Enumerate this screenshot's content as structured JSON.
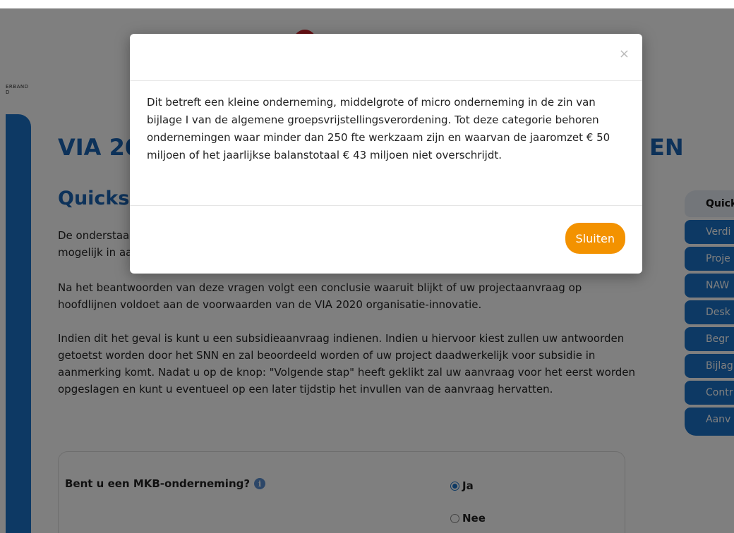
{
  "header": {
    "logo_text_line1": "ERBAND",
    "logo_text_line2": "D"
  },
  "main": {
    "title_left": "VIA 20",
    "title_right": "EN",
    "subtitle": "Quicks",
    "intro_line1": "De onderstaa",
    "intro_line2": "mogelijk in aa",
    "paragraph2": "Na het beantwoorden van deze vragen volgt een conclusie waaruit blijkt of uw projectaanvraag op hoofdlijnen voldoet aan de voorwaarden van de VIA 2020 organisatie-innovatie.",
    "paragraph3": "Indien dit het geval is kunt u een subsidieaanvraag indienen. Indien u hiervoor kiest zullen uw antwoorden getoetst worden door het SNN en zal beoordeeld worden of uw project daadwerkelijk voor subsidie in aanmerking komt. Nadat u op de knop: \"Volgende stap\" heeft geklikt zal uw aanvraag voor het eerst worden opgeslagen en kunt u eventueel op een later tijdstip het invullen van de aanvraag hervatten."
  },
  "form": {
    "question": "Bent u een MKB-onderneming?",
    "info_icon": "i",
    "options": [
      "Ja",
      "Nee"
    ],
    "selected": "Ja"
  },
  "side_nav": {
    "items": [
      "Quick",
      "Verdi",
      "Proje",
      "NAW",
      "Desk",
      "Begr",
      "Bijlag",
      "Contr",
      "Aanv"
    ]
  },
  "modal": {
    "close_symbol": "×",
    "body": "Dit betreft een kleine onderneming, middelgrote of micro onderneming in de zin van bijlage I van de algemene groepsvrijstellingsverordening. Tot deze categorie behoren ondernemingen waar minder dan 250 fte werkzaam zijn en waarvan de jaaromzet € 50 miljoen of het jaarlijkse balanstotaal € 43 miljoen niet overschrijdt.",
    "button": "Sluiten"
  },
  "colors": {
    "brand_blue": "#1b72c8",
    "title_blue": "#1b64b4",
    "accent_orange": "#f39200",
    "logo_red": "#d2232a"
  }
}
